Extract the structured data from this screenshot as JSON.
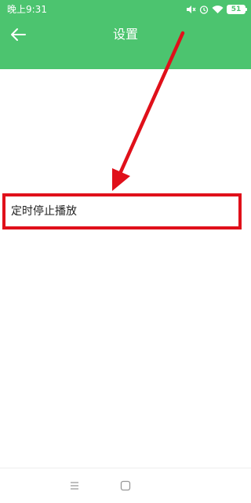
{
  "status_bar": {
    "time": "晚上9:31",
    "battery": "51",
    "icons": [
      "mute-icon",
      "alarm-icon",
      "wifi-icon",
      "battery-icon"
    ]
  },
  "header": {
    "title": "设置",
    "back_icon": "arrow-left-icon",
    "background_color": "#4cc46f"
  },
  "settings": {
    "items": [
      {
        "label": "定时停止播放"
      }
    ]
  },
  "annotation": {
    "color": "#e0101a",
    "shapes": [
      "arrow",
      "highlight-box"
    ]
  },
  "system_nav": {
    "icons": [
      "menu-icon",
      "home-icon"
    ]
  }
}
